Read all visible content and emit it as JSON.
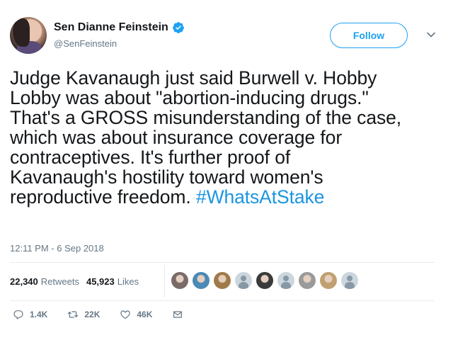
{
  "author": {
    "display_name": "Sen Dianne Feinstein",
    "handle": "@SenFeinstein",
    "verified": true
  },
  "follow_button": {
    "label": "Follow"
  },
  "tweet": {
    "text_line_1": "Judge Kavanaugh just said Burwell v. Hobby",
    "text_line_2": "Lobby was about \"abortion-inducing drugs.\"",
    "text_line_3": "That's a GROSS misunderstanding of the case,",
    "text_line_4": "which was about insurance coverage for",
    "text_line_5": "contraceptives. It's further proof of",
    "text_line_6": "Kavanaugh's hostility toward women's",
    "text_line_7_prefix": "reproductive freedom. ",
    "hashtag": "#WhatsAtStake",
    "timestamp": "12:11 PM - 6 Sep 2018"
  },
  "stats": {
    "retweets_count": "22,340",
    "retweets_label": "Retweets",
    "likes_count": "45,923",
    "likes_label": "Likes"
  },
  "likers": [
    {
      "name": "liker-avatar-1",
      "color": "#7a6a68"
    },
    {
      "name": "liker-avatar-2",
      "color": "#4a8ab5"
    },
    {
      "name": "liker-avatar-3",
      "color": "#a07a4a"
    },
    {
      "name": "liker-avatar-4",
      "color": "default"
    },
    {
      "name": "liker-avatar-5",
      "color": "#3a3a3a"
    },
    {
      "name": "liker-avatar-6",
      "color": "default"
    },
    {
      "name": "liker-avatar-7",
      "color": "#9a9a9a"
    },
    {
      "name": "liker-avatar-8",
      "color": "#c0a070"
    },
    {
      "name": "liker-avatar-9",
      "color": "default"
    }
  ],
  "actions": {
    "reply_count": "1.4K",
    "retweet_count": "22K",
    "like_count": "46K"
  },
  "colors": {
    "accent": "#1da1f2",
    "hashtag": "#1b95e0",
    "secondary_text": "#657786",
    "divider": "#e6ecf0"
  },
  "icons": {
    "verified": "verified-badge-icon",
    "chevron": "chevron-down-icon",
    "reply": "reply-icon",
    "retweet": "retweet-icon",
    "like": "heart-icon",
    "dm": "direct-message-icon"
  }
}
